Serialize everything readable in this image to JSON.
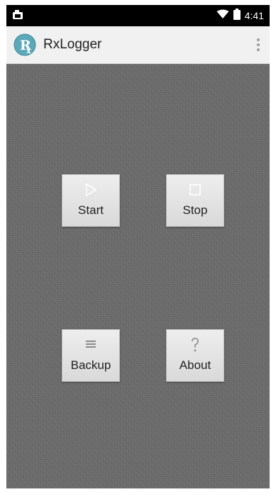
{
  "status_bar": {
    "time": "4:41",
    "left_icon": "screenshot-notification-icon",
    "right_icons": [
      "wifi-icon",
      "battery-icon"
    ]
  },
  "app_bar": {
    "title": "RxLogger",
    "logo_icon": "rx-logo-icon",
    "menu_icon": "overflow-menu-icon"
  },
  "actions": {
    "start": {
      "label": "Start",
      "icon": "play-icon"
    },
    "stop": {
      "label": "Stop",
      "icon": "stop-icon"
    },
    "backup": {
      "label": "Backup",
      "icon": "list-icon"
    },
    "about": {
      "label": "About",
      "icon": "question-icon"
    }
  },
  "colors": {
    "app_bar_bg": "#f1f1f1",
    "content_bg": "#6a6a6a",
    "tile_bg": "#e3e3e3",
    "logo_teal": "#5aa8b8"
  }
}
